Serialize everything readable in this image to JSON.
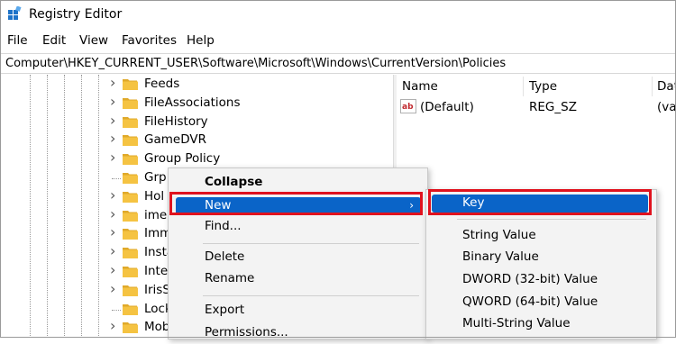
{
  "window": {
    "title": "Registry Editor",
    "icon": "registry-editor-icon"
  },
  "menubar": {
    "items": [
      "File",
      "Edit",
      "View",
      "Favorites",
      "Help"
    ]
  },
  "address": {
    "path": "Computer\\HKEY_CURRENT_USER\\Software\\Microsoft\\Windows\\CurrentVersion\\Policies"
  },
  "tree": {
    "items": [
      {
        "label": "Feeds",
        "expandable": true
      },
      {
        "label": "FileAssociations",
        "expandable": true
      },
      {
        "label": "FileHistory",
        "expandable": true
      },
      {
        "label": "GameDVR",
        "expandable": true
      },
      {
        "label": "Group Policy",
        "expandable": true
      },
      {
        "label": "Grp",
        "expandable": false
      },
      {
        "label": "Hol",
        "expandable": true
      },
      {
        "label": "ime",
        "expandable": true
      },
      {
        "label": "Imm",
        "expandable": true
      },
      {
        "label": "Insta",
        "expandable": true
      },
      {
        "label": "Inte",
        "expandable": true
      },
      {
        "label": "IrisS",
        "expandable": true
      },
      {
        "label": "Lock",
        "expandable": false
      },
      {
        "label": "Mob",
        "expandable": true
      }
    ]
  },
  "values_pane": {
    "columns": [
      "Name",
      "Type",
      "Dat"
    ],
    "rows": [
      {
        "name": "(Default)",
        "type": "REG_SZ",
        "data": "(val"
      }
    ]
  },
  "context_menu": {
    "collapse": "Collapse",
    "new": "New",
    "find": "Find...",
    "delete": "Delete",
    "rename": "Rename",
    "export": "Export",
    "permissions": "Permissions..."
  },
  "submenu": {
    "key": "Key",
    "items": [
      "String Value",
      "Binary Value",
      "DWORD (32-bit) Value",
      "QWORD (64-bit) Value",
      "Multi-String Value"
    ]
  },
  "colors": {
    "highlight": "#0a64c8",
    "callout": "#e0121e",
    "folder": "#f5c342"
  }
}
